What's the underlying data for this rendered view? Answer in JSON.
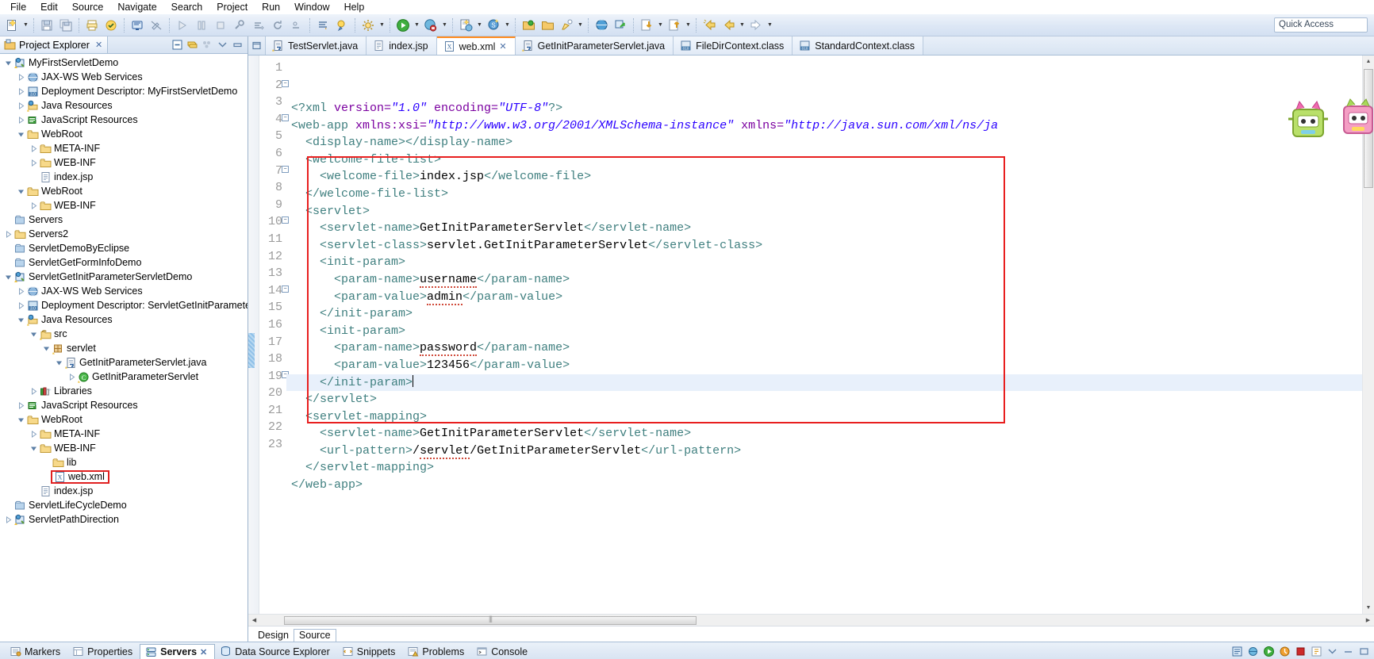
{
  "menu": {
    "items": [
      {
        "label": "File"
      },
      {
        "label": "Edit"
      },
      {
        "label": "Source"
      },
      {
        "label": "Navigate"
      },
      {
        "label": "Search"
      },
      {
        "label": "Project"
      },
      {
        "label": "Run"
      },
      {
        "label": "Window"
      },
      {
        "label": "Help"
      }
    ]
  },
  "toolbar": {
    "quick_access": "Quick Access",
    "icons": [
      "new-wizard-icon",
      "new-dropdown-arrow",
      "save-icon",
      "save-all-icon",
      "print-icon",
      "validate-icon",
      "open-console-icon",
      "toggle-mark-occurrences-icon",
      "step-into-icon",
      "pause-icon",
      "terminate-icon",
      "build-icon",
      "debug-last-icon",
      "refresh-icon",
      "skip-breakpoints-icon",
      "next-annotation-icon",
      "previous-annotation-icon",
      "external-tools-icon",
      "run-icon",
      "run-dropdown-arrow",
      "debug-icon",
      "debug-dropdown-arrow",
      "new-java-project-icon",
      "new-dropdown-arrow-2",
      "new-class-icon",
      "new-class-dropdown-arrow",
      "open-type-icon",
      "open-task-icon",
      "search-icon",
      "search-dropdown-arrow",
      "globe-icon",
      "link-icon",
      "import-icon",
      "import-dropdown-arrow",
      "export-icon",
      "export-dropdown-arrow",
      "previous-edit-icon",
      "back-icon",
      "back-dropdown-arrow",
      "forward-icon",
      "forward-dropdown-arrow"
    ]
  },
  "explorer": {
    "tab_label": "Project Explorer",
    "tab_close": "✕",
    "tools": [
      "collapse-all-icon",
      "link-with-editor-icon",
      "view-menu-icon",
      "minimize-icon",
      "maximize-icon"
    ],
    "tree": [
      {
        "depth": 0,
        "twisty": "expanded",
        "icon": "web-project-icon",
        "label": "MyFirstServletDemo"
      },
      {
        "depth": 1,
        "twisty": "collapsed",
        "icon": "jaxws-icon",
        "label": "JAX-WS Web Services"
      },
      {
        "depth": 1,
        "twisty": "collapsed",
        "icon": "deployment-descriptor-icon",
        "label": "Deployment Descriptor: MyFirstServletDemo"
      },
      {
        "depth": 1,
        "twisty": "collapsed",
        "icon": "java-resources-icon",
        "label": "Java Resources"
      },
      {
        "depth": 1,
        "twisty": "collapsed",
        "icon": "javascript-resources-icon",
        "label": "JavaScript Resources"
      },
      {
        "depth": 1,
        "twisty": "expanded",
        "icon": "folder-icon",
        "label": "WebRoot"
      },
      {
        "depth": 2,
        "twisty": "collapsed",
        "icon": "folder-icon",
        "label": "META-INF"
      },
      {
        "depth": 2,
        "twisty": "collapsed",
        "icon": "folder-icon",
        "label": "WEB-INF"
      },
      {
        "depth": 2,
        "twisty": "none",
        "icon": "jsp-file-icon",
        "label": "index.jsp"
      },
      {
        "depth": 1,
        "twisty": "expanded",
        "icon": "folder-icon",
        "label": "WebRoot"
      },
      {
        "depth": 2,
        "twisty": "collapsed",
        "icon": "folder-icon",
        "label": "WEB-INF"
      },
      {
        "depth": 0,
        "twisty": "none",
        "icon": "closed-project-icon",
        "label": "Servers"
      },
      {
        "depth": 0,
        "twisty": "collapsed",
        "icon": "folder-icon",
        "label": "Servers2"
      },
      {
        "depth": 0,
        "twisty": "none",
        "icon": "closed-project-icon",
        "label": "ServletDemoByEclipse"
      },
      {
        "depth": 0,
        "twisty": "none",
        "icon": "closed-project-icon",
        "label": "ServletGetFormInfoDemo"
      },
      {
        "depth": 0,
        "twisty": "expanded",
        "icon": "web-project-icon",
        "label": "ServletGetInitParameterServletDemo"
      },
      {
        "depth": 1,
        "twisty": "collapsed",
        "icon": "jaxws-icon",
        "label": "JAX-WS Web Services"
      },
      {
        "depth": 1,
        "twisty": "collapsed",
        "icon": "deployment-descriptor-icon",
        "label": "Deployment Descriptor: ServletGetInitParameter!"
      },
      {
        "depth": 1,
        "twisty": "expanded",
        "icon": "java-resources-icon",
        "label": "Java Resources"
      },
      {
        "depth": 2,
        "twisty": "expanded",
        "icon": "source-folder-icon",
        "label": "src"
      },
      {
        "depth": 3,
        "twisty": "expanded",
        "icon": "package-icon",
        "label": "servlet"
      },
      {
        "depth": 4,
        "twisty": "expanded",
        "icon": "java-file-icon",
        "label": "GetInitParameterServlet.java"
      },
      {
        "depth": 5,
        "twisty": "collapsed",
        "icon": "java-class-icon",
        "label": "GetInitParameterServlet"
      },
      {
        "depth": 2,
        "twisty": "collapsed",
        "icon": "libraries-icon",
        "label": "Libraries"
      },
      {
        "depth": 1,
        "twisty": "collapsed",
        "icon": "javascript-resources-icon",
        "label": "JavaScript Resources"
      },
      {
        "depth": 1,
        "twisty": "expanded",
        "icon": "folder-icon",
        "label": "WebRoot"
      },
      {
        "depth": 2,
        "twisty": "collapsed",
        "icon": "folder-icon",
        "label": "META-INF"
      },
      {
        "depth": 2,
        "twisty": "expanded",
        "icon": "folder-icon",
        "label": "WEB-INF"
      },
      {
        "depth": 3,
        "twisty": "none",
        "icon": "folder-icon",
        "label": "lib"
      },
      {
        "depth": 3,
        "twisty": "none",
        "icon": "xml-file-icon",
        "label": "web.xml",
        "highlighted": true
      },
      {
        "depth": 2,
        "twisty": "none",
        "icon": "jsp-file-icon",
        "label": "index.jsp"
      },
      {
        "depth": 0,
        "twisty": "none",
        "icon": "closed-project-icon",
        "label": "ServletLifeCycleDemo"
      },
      {
        "depth": 0,
        "twisty": "collapsed",
        "icon": "web-project-icon",
        "label": "ServletPathDirection"
      }
    ]
  },
  "editor": {
    "tabs": [
      {
        "label": "TestServlet.java",
        "icon": "java-file-icon",
        "active": false,
        "closeable": false
      },
      {
        "label": "index.jsp",
        "icon": "jsp-file-icon",
        "active": false,
        "closeable": false
      },
      {
        "label": "web.xml",
        "icon": "xml-file-icon",
        "active": true,
        "closeable": true
      },
      {
        "label": "GetInitParameterServlet.java",
        "icon": "java-file-icon",
        "active": false,
        "closeable": false
      },
      {
        "label": "FileDirContext.class",
        "icon": "class-file-icon",
        "active": false,
        "closeable": false
      },
      {
        "label": "StandardContext.class",
        "icon": "class-file-icon",
        "active": false,
        "closeable": false
      }
    ],
    "tab_close_glyph": "✕",
    "lines": [
      {
        "n": 1,
        "fold": false,
        "current": false,
        "segs": [
          {
            "t": "tag",
            "s": "<?xml "
          },
          {
            "t": "attr",
            "s": "version="
          },
          {
            "t": "val",
            "s": "\"1.0\""
          },
          {
            "t": "attr",
            "s": " encoding="
          },
          {
            "t": "val",
            "s": "\"UTF-8\""
          },
          {
            "t": "tag",
            "s": "?>"
          }
        ]
      },
      {
        "n": 2,
        "fold": true,
        "current": false,
        "segs": [
          {
            "t": "tag",
            "s": "<web-app "
          },
          {
            "t": "attr",
            "s": "xmlns:xsi="
          },
          {
            "t": "val",
            "s": "\"http://www.w3.org/2001/XMLSchema-instance\""
          },
          {
            "t": "attr",
            "s": " xmlns="
          },
          {
            "t": "val",
            "s": "\"http://java.sun.com/xml/ns/ja"
          }
        ]
      },
      {
        "n": 3,
        "fold": false,
        "current": false,
        "segs": [
          {
            "t": "plain",
            "s": "  "
          },
          {
            "t": "tag",
            "s": "<display-name>"
          },
          {
            "t": "tag",
            "s": "</display-name>"
          }
        ]
      },
      {
        "n": 4,
        "fold": true,
        "current": false,
        "segs": [
          {
            "t": "plain",
            "s": "  "
          },
          {
            "t": "tag",
            "s": "<welcome-file-list>"
          }
        ]
      },
      {
        "n": 5,
        "fold": false,
        "current": false,
        "segs": [
          {
            "t": "plain",
            "s": "    "
          },
          {
            "t": "tag",
            "s": "<welcome-file>"
          },
          {
            "t": "txt",
            "s": "index.jsp"
          },
          {
            "t": "tag",
            "s": "</welcome-file>"
          }
        ]
      },
      {
        "n": 6,
        "fold": false,
        "current": false,
        "segs": [
          {
            "t": "plain",
            "s": "  "
          },
          {
            "t": "tag",
            "s": "</welcome-file-list>"
          }
        ]
      },
      {
        "n": 7,
        "fold": true,
        "current": false,
        "segs": [
          {
            "t": "plain",
            "s": "  "
          },
          {
            "t": "tag",
            "s": "<servlet>"
          }
        ]
      },
      {
        "n": 8,
        "fold": false,
        "current": false,
        "segs": [
          {
            "t": "plain",
            "s": "    "
          },
          {
            "t": "tag",
            "s": "<servlet-name>"
          },
          {
            "t": "txt",
            "s": "GetInitParameterServlet"
          },
          {
            "t": "tag",
            "s": "</servlet-name>"
          }
        ]
      },
      {
        "n": 9,
        "fold": false,
        "current": false,
        "segs": [
          {
            "t": "plain",
            "s": "    "
          },
          {
            "t": "tag",
            "s": "<servlet-class>"
          },
          {
            "t": "txt",
            "s": "servlet.GetInitParameterServlet"
          },
          {
            "t": "tag",
            "s": "</servlet-class>"
          }
        ]
      },
      {
        "n": 10,
        "fold": true,
        "current": false,
        "segs": [
          {
            "t": "plain",
            "s": "    "
          },
          {
            "t": "tag",
            "s": "<init-param>"
          }
        ]
      },
      {
        "n": 11,
        "fold": false,
        "current": false,
        "segs": [
          {
            "t": "plain",
            "s": "      "
          },
          {
            "t": "tag",
            "s": "<param-name>"
          },
          {
            "t": "spell",
            "s": "username"
          },
          {
            "t": "tag",
            "s": "</param-name>"
          }
        ]
      },
      {
        "n": 12,
        "fold": false,
        "current": false,
        "segs": [
          {
            "t": "plain",
            "s": "      "
          },
          {
            "t": "tag",
            "s": "<param-value>"
          },
          {
            "t": "spell",
            "s": "admin"
          },
          {
            "t": "tag",
            "s": "</param-value>"
          }
        ]
      },
      {
        "n": 13,
        "fold": false,
        "current": false,
        "segs": [
          {
            "t": "plain",
            "s": "    "
          },
          {
            "t": "tag",
            "s": "</init-param>"
          }
        ]
      },
      {
        "n": 14,
        "fold": true,
        "current": false,
        "segs": [
          {
            "t": "plain",
            "s": "    "
          },
          {
            "t": "tag",
            "s": "<init-param>"
          }
        ]
      },
      {
        "n": 15,
        "fold": false,
        "current": false,
        "segs": [
          {
            "t": "plain",
            "s": "      "
          },
          {
            "t": "tag",
            "s": "<param-name>"
          },
          {
            "t": "spell",
            "s": "password"
          },
          {
            "t": "tag",
            "s": "</param-name>"
          }
        ]
      },
      {
        "n": 16,
        "fold": false,
        "current": false,
        "segs": [
          {
            "t": "plain",
            "s": "      "
          },
          {
            "t": "tag",
            "s": "<param-value>"
          },
          {
            "t": "txt",
            "s": "123456"
          },
          {
            "t": "tag",
            "s": "</param-value>"
          }
        ]
      },
      {
        "n": 17,
        "fold": false,
        "current": true,
        "segs": [
          {
            "t": "plain",
            "s": "    "
          },
          {
            "t": "tag",
            "s": "</init-param>"
          },
          {
            "t": "caret",
            "s": ""
          }
        ]
      },
      {
        "n": 18,
        "fold": false,
        "current": false,
        "segs": [
          {
            "t": "plain",
            "s": "  "
          },
          {
            "t": "tag",
            "s": "</servlet>"
          }
        ]
      },
      {
        "n": 19,
        "fold": true,
        "current": false,
        "segs": [
          {
            "t": "plain",
            "s": "  "
          },
          {
            "t": "tag",
            "s": "<servlet-mapping>"
          }
        ]
      },
      {
        "n": 20,
        "fold": false,
        "current": false,
        "segs": [
          {
            "t": "plain",
            "s": "    "
          },
          {
            "t": "tag",
            "s": "<servlet-name>"
          },
          {
            "t": "txt",
            "s": "GetInitParameterServlet"
          },
          {
            "t": "tag",
            "s": "</servlet-name>"
          }
        ]
      },
      {
        "n": 21,
        "fold": false,
        "current": false,
        "segs": [
          {
            "t": "plain",
            "s": "    "
          },
          {
            "t": "tag",
            "s": "<url-pattern>"
          },
          {
            "t": "txt",
            "s": "/"
          },
          {
            "t": "spell",
            "s": "servlet"
          },
          {
            "t": "txt",
            "s": "/GetInitParameterServlet"
          },
          {
            "t": "tag",
            "s": "</url-pattern>"
          }
        ]
      },
      {
        "n": 22,
        "fold": false,
        "current": false,
        "segs": [
          {
            "t": "plain",
            "s": "  "
          },
          {
            "t": "tag",
            "s": "</servlet-mapping>"
          }
        ]
      },
      {
        "n": 23,
        "fold": false,
        "current": false,
        "segs": [
          {
            "t": "tag",
            "s": "</web-app>"
          }
        ]
      }
    ],
    "design_source_tabs": [
      {
        "label": "Design",
        "active": false
      },
      {
        "label": "Source",
        "active": true
      }
    ]
  },
  "bottom": {
    "tabs": [
      {
        "label": "Markers",
        "icon": "markers-icon",
        "active": false,
        "closeable": false
      },
      {
        "label": "Properties",
        "icon": "properties-icon",
        "active": false,
        "closeable": false
      },
      {
        "label": "Servers",
        "icon": "servers-icon",
        "active": true,
        "closeable": true
      },
      {
        "label": "Data Source Explorer",
        "icon": "datasource-icon",
        "active": false,
        "closeable": false
      },
      {
        "label": "Snippets",
        "icon": "snippets-icon",
        "active": false,
        "closeable": false
      },
      {
        "label": "Problems",
        "icon": "problems-icon",
        "active": false,
        "closeable": false
      },
      {
        "label": "Console",
        "icon": "console-icon",
        "active": false,
        "closeable": false
      }
    ],
    "close_glyph": "✕",
    "right_icons": [
      "new-server-icon",
      "debug-server-icon",
      "start-server-icon",
      "profile-server-icon",
      "stop-server-icon",
      "publish-icon",
      "view-menu-icon",
      "minimize-icon",
      "maximize-icon"
    ]
  },
  "colors": {
    "accent_orange": "#ff8c21",
    "highlight_red": "#e81f1f",
    "xml_tag": "#3f7f7f",
    "xml_attr": "#7b00a0",
    "xml_value": "#2a00ff",
    "current_line": "#e8f0fb"
  }
}
